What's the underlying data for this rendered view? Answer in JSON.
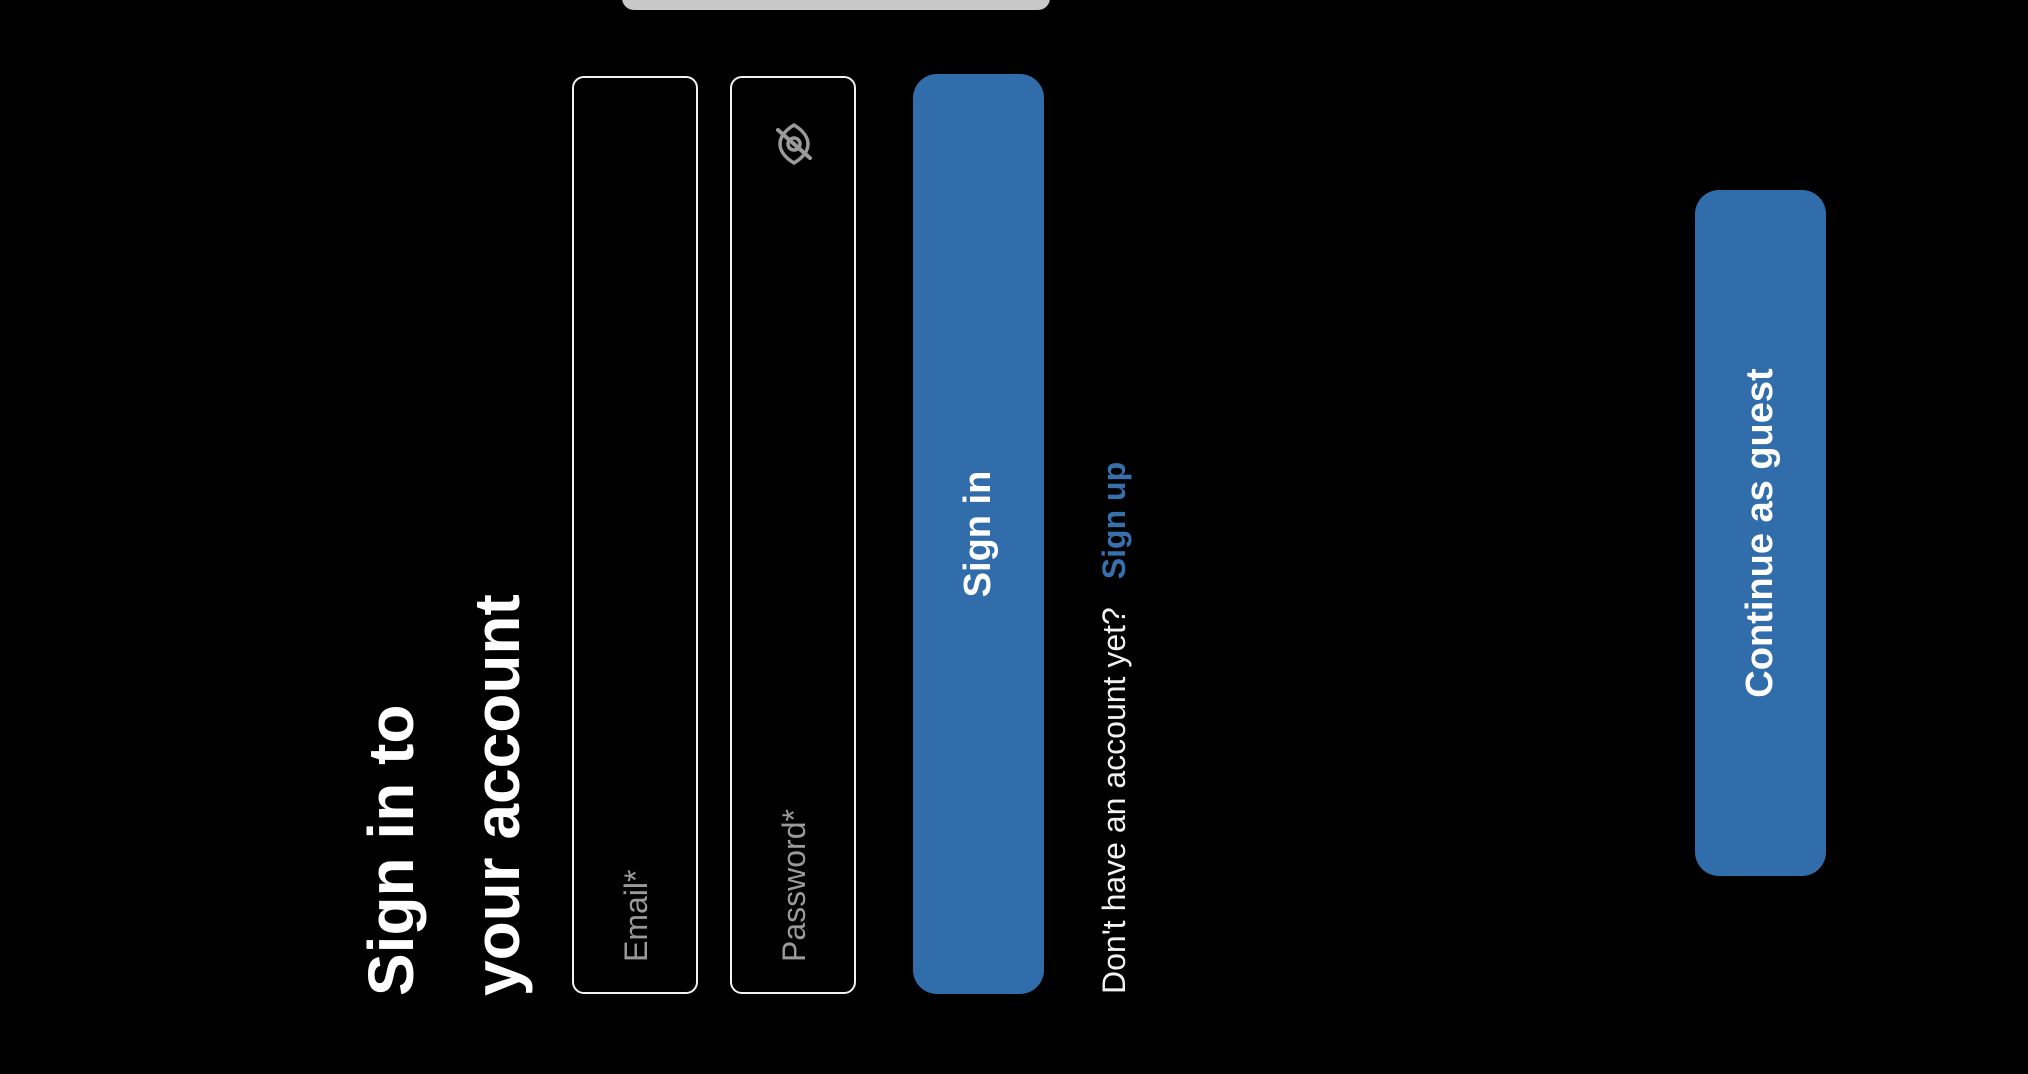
{
  "title": {
    "line1": "Sign in to",
    "line2": "your account"
  },
  "email_field": {
    "placeholder": "Email*",
    "value": ""
  },
  "password_field": {
    "placeholder": "Password*",
    "value": "",
    "visibility_icon": "eye-off-icon"
  },
  "sign_in_button": {
    "label": "Sign in"
  },
  "signup": {
    "prompt": "Don't have an account yet?",
    "link_label": "Sign up"
  },
  "guest_button": {
    "label": "Continue as guest"
  },
  "colors": {
    "background": "#000000",
    "accent": "#316dab",
    "text": "#ffffff",
    "placeholder": "#9a9a9a"
  }
}
